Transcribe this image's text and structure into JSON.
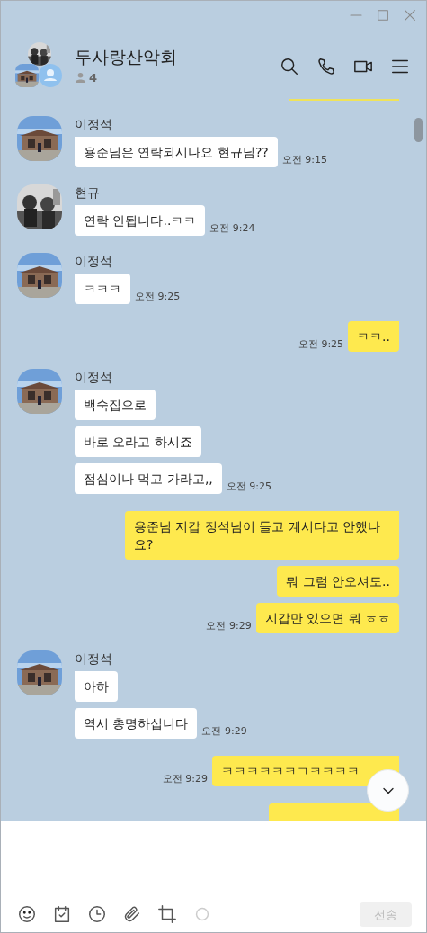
{
  "chat": {
    "title": "두사랑산악회",
    "member_count": "4"
  },
  "messages": [
    {
      "kind": "received",
      "sender": "이정석",
      "bubbles": [
        "용준님은 연락되시나요 현규님??"
      ],
      "time": "오전 9:15"
    },
    {
      "kind": "received",
      "sender": "현규",
      "bubbles": [
        "연락 안됩니다..ㅋㅋ"
      ],
      "time": "오전 9:24"
    },
    {
      "kind": "received",
      "sender": "이정석",
      "bubbles": [
        "ㅋㅋㅋ"
      ],
      "time": "오전 9:25"
    },
    {
      "kind": "sent",
      "bubbles": [
        "ㅋㅋ.."
      ],
      "time": "오전 9:25"
    },
    {
      "kind": "received",
      "sender": "이정석",
      "bubbles": [
        "백숙집으로",
        "바로 오라고 하시죠",
        "점심이나 먹고 가라고,,"
      ],
      "time": "오전 9:25"
    },
    {
      "kind": "sent",
      "bubbles": [
        "용준님 지갑 정석님이 들고 계시다고 안했나요?",
        "뭐 그럼 안오셔도..",
        "지갑만 있으면 뭐 ㅎㅎ"
      ],
      "time": "오전 9:29"
    },
    {
      "kind": "received",
      "sender": "이정석",
      "bubbles": [
        "아하",
        "역시 총명하십니다"
      ],
      "time": "오전 9:29"
    },
    {
      "kind": "sent",
      "bubbles": [
        "ㅋㅋㅋㅋㅋㅋㄱㅋㅋㅋㅋ"
      ],
      "time": "오전 9:29"
    }
  ],
  "send_button": {
    "label": "전송",
    "disabled": true
  }
}
